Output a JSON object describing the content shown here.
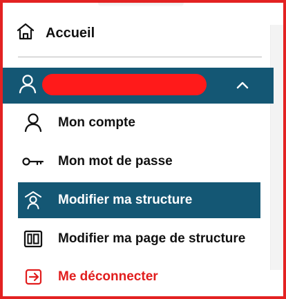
{
  "menu": {
    "home_label": "Accueil",
    "items": [
      {
        "label": "Mon compte"
      },
      {
        "label": "Mon mot de passe"
      },
      {
        "label": "Modifier ma structure"
      },
      {
        "label": "Modifier ma page de structure"
      },
      {
        "label": "Me déconnecter"
      }
    ]
  },
  "colors": {
    "accent": "#145774",
    "danger": "#E11D1D",
    "text": "#111111",
    "background": "#FFFFFF",
    "annotation_border": "#E32222",
    "redaction": "#FF1A1A"
  },
  "icons": {
    "home": "home-icon",
    "user": "user-icon",
    "chevron": "chevron-up-icon",
    "account": "user-icon",
    "password": "key-icon",
    "structure": "structure-icon",
    "structure_page": "layout-icon",
    "logout": "logout-icon"
  }
}
